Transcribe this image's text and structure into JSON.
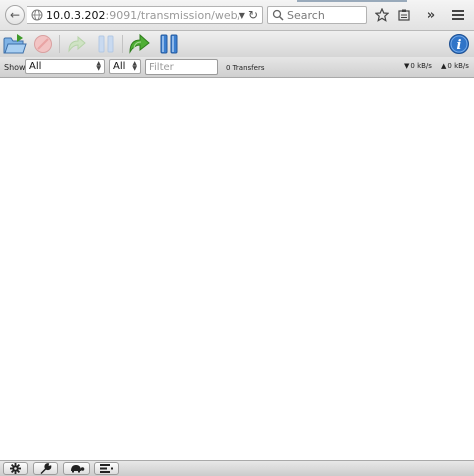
{
  "browser": {
    "url_host": "10.0.3.202",
    "url_rest": ":9091/transmission/web/",
    "search_placeholder": "Search"
  },
  "toolbar": {
    "buttons": [
      "open-torrent",
      "remove-torrent",
      "resume-selected",
      "pause-selected",
      "resume-all",
      "pause-all",
      "inspector"
    ]
  },
  "filterbar": {
    "show_label": "Show",
    "status_filter": "All",
    "tracker_filter": "All",
    "filter_placeholder": "Filter",
    "transfers_count": "0 Transfers",
    "download_speed": "0 kB/s",
    "upload_speed": "0 kB/s"
  },
  "colors": {
    "accent_green": "#3f9a2a",
    "accent_blue": "#3b7fd0",
    "remove_red": "#d9534f"
  }
}
